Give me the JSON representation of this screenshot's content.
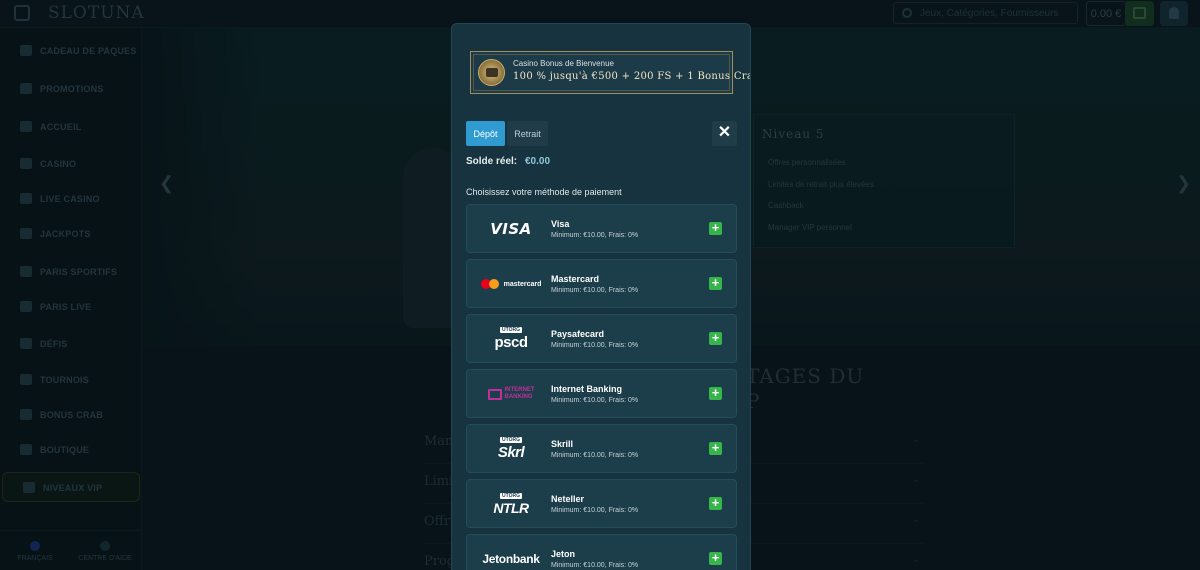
{
  "app": {
    "logo": "SLOTUNA"
  },
  "header": {
    "search_placeholder": "Jeux, Catégories, Fournisseurs",
    "balance": "0.00 €"
  },
  "sidebar": {
    "items": [
      {
        "label": "CADEAU DE PAQUES",
        "icon": "gift-icon"
      },
      {
        "label": "PROMOTIONS",
        "icon": "promotions-icon"
      },
      {
        "label": "ACCUEIL",
        "icon": "home-icon"
      },
      {
        "label": "CASINO",
        "icon": "casino-icon"
      },
      {
        "label": "LIVE CASINO",
        "icon": "live-casino-icon"
      },
      {
        "label": "JACKPOTS",
        "icon": "jackpot-icon"
      },
      {
        "label": "PARIS SPORTIFS",
        "icon": "sports-icon"
      },
      {
        "label": "PARIS LIVE",
        "icon": "live-bets-icon"
      },
      {
        "label": "DÉFIS",
        "icon": "challenge-icon"
      },
      {
        "label": "TOURNOIS",
        "icon": "tournament-icon"
      },
      {
        "label": "BONUS CRAB",
        "icon": "crab-icon"
      },
      {
        "label": "BOUTIQUE",
        "icon": "shop-icon"
      },
      {
        "label": "NIVEAUX VIP",
        "icon": "vip-icon"
      }
    ],
    "bottom": {
      "language": "FRANÇAIS",
      "help": "CENTRE D'AIDE"
    }
  },
  "background": {
    "vip_card": {
      "title": "Niveau 5",
      "lines": [
        "Offres personnalisées",
        "Limites de retrait plus élevées",
        "Cashback",
        "Manager VIP personnel"
      ]
    },
    "avantages_line1": "TAGES DU",
    "avantages_line2": "P",
    "faq": [
      "Man",
      "Limi",
      "Offr",
      "Prog"
    ]
  },
  "modal": {
    "bonus_small": "Casino Bonus de Bienvenue",
    "bonus_big": "100 % jusqu'à €500 + 200 FS + 1 Bonus Crab",
    "tab_deposit": "Dépôt",
    "tab_withdraw": "Retrait",
    "close": "✕",
    "solde_label": "Solde réel:",
    "solde_value": "€0.00",
    "choose_label": "Choisissez votre méthode de paiement",
    "methods": [
      {
        "name": "Visa",
        "sub": "Minimum: €10.00, Frais: 0%",
        "logo": "VISA"
      },
      {
        "name": "Mastercard",
        "sub": "Minimum: €10.00, Frais: 0%",
        "logo": "mastercard"
      },
      {
        "name": "Paysafecard",
        "sub": "Minimum: €10.00, Frais: 0%",
        "logo": "pscd",
        "badge": "UTORG"
      },
      {
        "name": "Internet Banking",
        "sub": "Minimum: €10.00, Frais: 0%",
        "logo_line1": "INTERNET",
        "logo_line2": "BANKING"
      },
      {
        "name": "Skrill",
        "sub": "Minimum: €10.00, Frais: 0%",
        "logo": "Skrl",
        "badge": "UTORG"
      },
      {
        "name": "Neteller",
        "sub": "Minimum: €10.00, Frais: 0%",
        "logo": "NTLR",
        "badge": "UTORG"
      },
      {
        "name": "Jeton",
        "sub": "Minimum: €10.00, Frais: 0%",
        "logo": "Jetonbank"
      }
    ]
  },
  "colors": {
    "accent": "#2f9bd0",
    "add_green": "#36b54a",
    "bonus_gold": "#a18d5c"
  }
}
